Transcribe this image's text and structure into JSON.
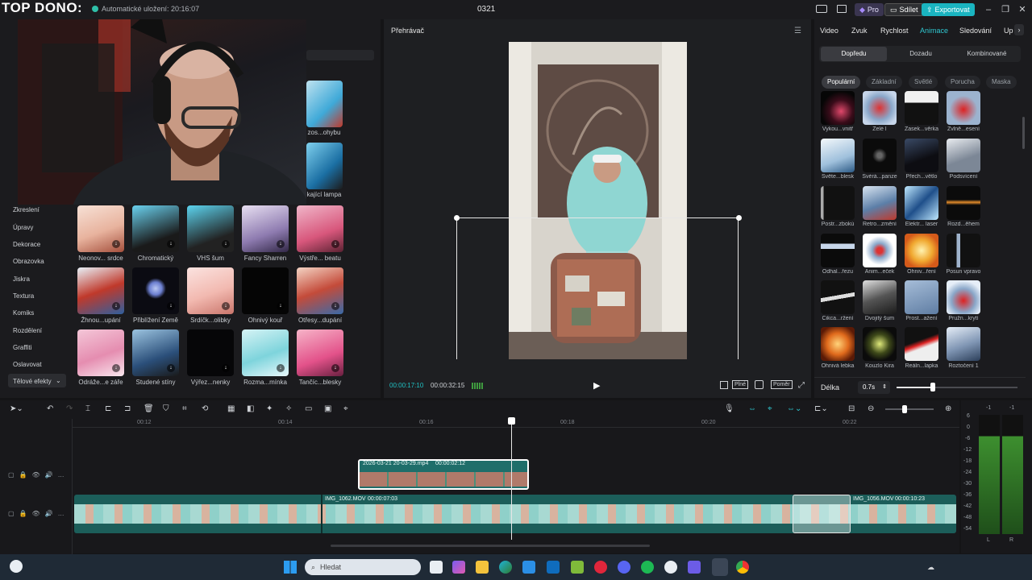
{
  "window": {
    "overlay_title": "TOP DONO:",
    "autosave": "Automatické uložení: 20:16:07",
    "project_name": "0321",
    "pro": "Pro",
    "share": "Sdílet",
    "export": "Exportovat"
  },
  "leftnav": {
    "items": [
      "Zkreslení",
      "Úpravy",
      "Dekorace",
      "Obrazovka",
      "Jiskra",
      "Textura",
      "Komiks",
      "Rozdělení",
      "Graffiti",
      "Oslavovat",
      "Tělové efekty"
    ]
  },
  "assets": {
    "partial_labels": [
      "zos...ohybu",
      "kající lampa"
    ],
    "rows": [
      [
        "Neonov... srdce",
        "Chromatický",
        "VHS šum",
        "Fancy Sharren",
        "Výstře... beatu"
      ],
      [
        "Žhnou...upání",
        "Přiblížení Země",
        "Srdíčk...olibky",
        "Ohnivý kouř",
        "Otřesy...dupání"
      ],
      [
        "Odráže...e záře",
        "Studené stíny",
        "Výřez...nenky",
        "Rozma...mínka",
        "Tančíc...blesky"
      ]
    ]
  },
  "player": {
    "label": "Přehrávač",
    "current_time": "00:00:17:10",
    "total_time": "00:00:32:15",
    "btn_full": "Plné",
    "btn_ratio": "Poměr"
  },
  "right": {
    "tabs": [
      "Video",
      "Zvuk",
      "Rychlost",
      "Animace",
      "Sledování",
      "Up"
    ],
    "active_tab": "Animace",
    "segments": [
      "Dopředu",
      "Dozadu",
      "Kombinované"
    ],
    "chips": [
      "Populární",
      "Základní",
      "Světlé",
      "Porucha",
      "Maska"
    ],
    "fx": [
      [
        "Vykou...vnitř",
        "Želé I",
        "Zasek...věrka",
        "Zvlně...esení"
      ],
      [
        "Světe...blesk",
        "Svérá...panze",
        "Přech...větlo",
        "Podsvícení"
      ],
      [
        "Postr...zbokú",
        "Retro...změní",
        "Elektr... laser",
        "Rozd...ěhem"
      ],
      [
        "Odhal...řezu",
        "Anim...eček",
        "Ohniv...ření",
        "Posun vpravo"
      ],
      [
        "Cikca...ržení",
        "Dvojitý šum",
        "Prost...ažení",
        "Pružn...krytí"
      ],
      [
        "Ohnivá lebka",
        "Kouzlo Kira",
        "Reáln...lapka",
        "Roztočení 1"
      ]
    ],
    "duration_label": "Délka",
    "duration_value": "0.7s"
  },
  "timeline": {
    "ruler": [
      "00:12",
      "00:14",
      "00:16",
      "00:18",
      "00:20",
      "00:22"
    ],
    "clip_overlay": {
      "name": "2026-03-21 20-03-29.mp4",
      "duration": "00:00:02:12"
    },
    "clip_main_a": {
      "name": "IMG_1062.MOV",
      "duration": "00:00:07:03"
    },
    "clip_main_b": {
      "name": "IMG_1056.MOV",
      "duration": "00:00:10:23"
    },
    "meter_labels": [
      "6",
      "0",
      "-6",
      "-12",
      "-18",
      "-24",
      "-30",
      "-36",
      "-42",
      "-48",
      "-54"
    ],
    "meter_lr": [
      "L",
      "R"
    ],
    "meter_top": [
      "-1",
      "-1"
    ]
  },
  "taskbar": {
    "search": "Hledat"
  }
}
